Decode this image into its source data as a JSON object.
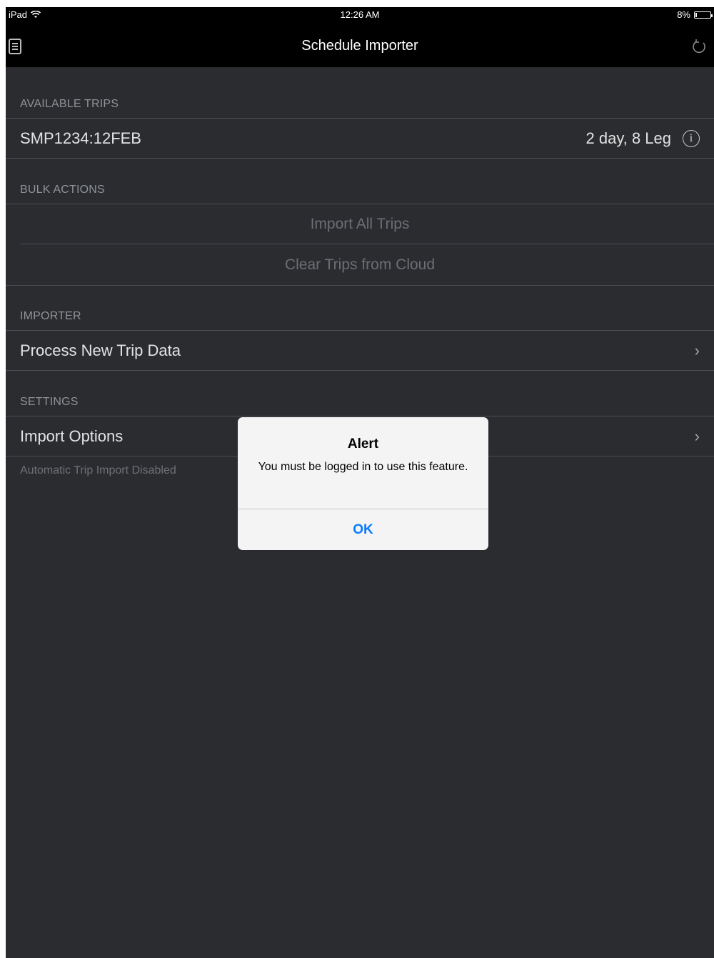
{
  "status_bar": {
    "device": "iPad",
    "time": "12:26 AM",
    "battery": "8%"
  },
  "nav": {
    "title": "Schedule Importer",
    "menu_icon": "menu-icon",
    "refresh_icon": "refresh-icon"
  },
  "sections": {
    "available_trips": {
      "header": "AVAILABLE TRIPS",
      "trip": {
        "name": "SMP1234:12FEB",
        "detail": "2 day, 8 Leg"
      }
    },
    "bulk_actions": {
      "header": "BULK ACTIONS",
      "import_all": "Import All Trips",
      "clear_cloud": "Clear Trips from Cloud"
    },
    "importer": {
      "header": "IMPORTER",
      "process": "Process New Trip Data"
    },
    "settings": {
      "header": "SETTINGS",
      "import_options": "Import Options",
      "footer": "Automatic Trip Import Disabled"
    }
  },
  "alert": {
    "title": "Alert",
    "message": "You must be logged in to use this feature.",
    "ok": "OK"
  },
  "colors": {
    "background": "#2a2c30",
    "bar": "#000000",
    "alert_button": "#0a7aff"
  }
}
